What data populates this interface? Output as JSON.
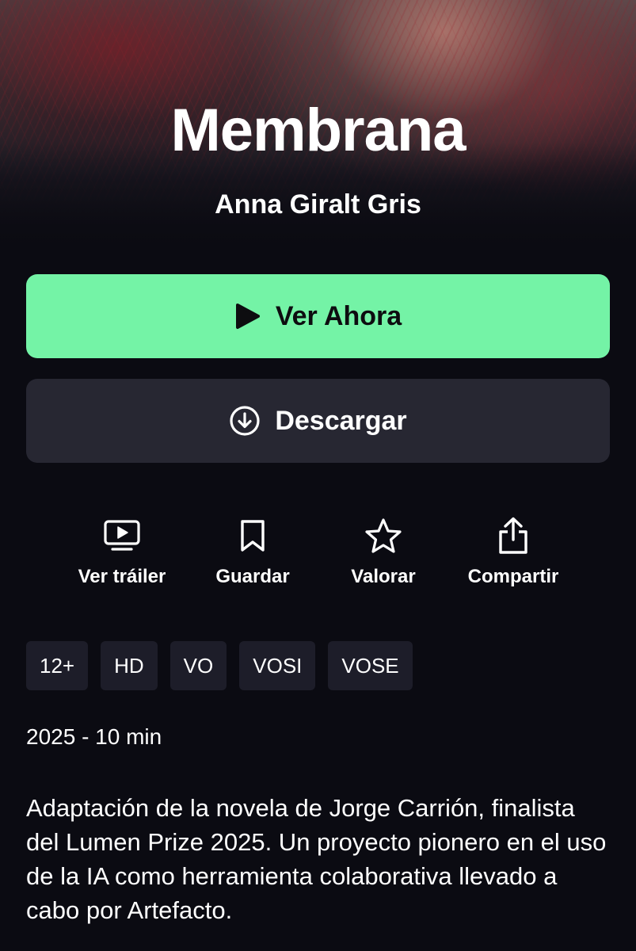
{
  "header": {
    "title": "Membrana",
    "director": "Anna Giralt Gris"
  },
  "buttons": {
    "watch_label": "Ver Ahora",
    "watch_icon": "play-icon",
    "watch_color": "#74f3a6",
    "download_label": "Descargar",
    "download_icon": "download-circle-icon",
    "download_color": "#272732"
  },
  "actions": [
    {
      "label": "Ver tráiler",
      "icon": "trailer-icon"
    },
    {
      "label": "Guardar",
      "icon": "bookmark-icon"
    },
    {
      "label": "Valorar",
      "icon": "star-icon"
    },
    {
      "label": "Compartir",
      "icon": "share-icon"
    }
  ],
  "badges": [
    "12+",
    "HD",
    "VO",
    "VOSI",
    "VOSE"
  ],
  "meta": "2025 - 10 min",
  "description": "Adaptación de la novela de Jorge Carrión, finalista del Lumen Prize 2025. Un proyecto pionero en el uso de la IA como herramienta colaborativa llevado a cabo por Artefacto."
}
